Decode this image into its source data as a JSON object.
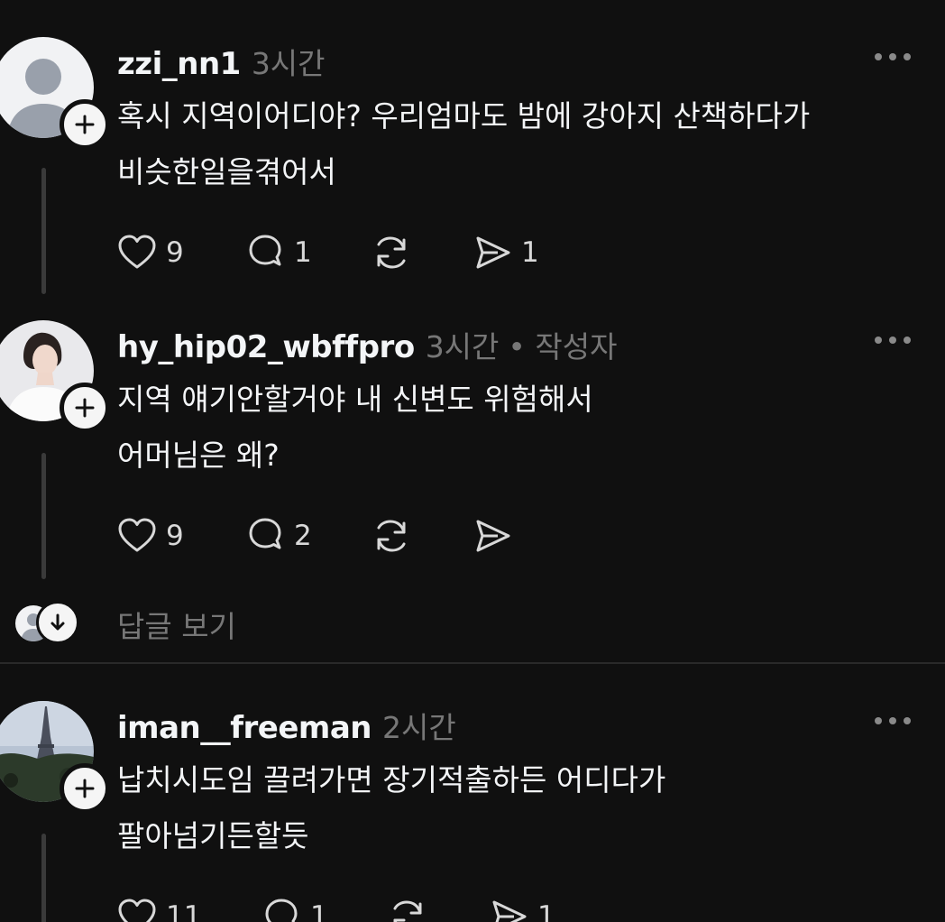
{
  "comments": [
    {
      "username": "zzi_nn1",
      "time": "3시간",
      "author_tag": "",
      "lines": [
        "혹시 지역이어디야? 우리엄마도 밤에 강아지 산책하다가",
        "비슷한일을겪어서"
      ],
      "likes": "9",
      "replies": "1",
      "reposts": "",
      "shares": "1",
      "avatar": "default-avatar"
    },
    {
      "username": "hy_hip02_wbffpro",
      "time": "3시간",
      "author_tag": "• 작성자",
      "lines": [
        "지역 얘기안할거야 내 신변도 위험해서",
        "어머님은 왜?"
      ],
      "likes": "9",
      "replies": "2",
      "reposts": "",
      "shares": "",
      "avatar": "woman-portrait-avatar"
    },
    {
      "username": "iman__freeman",
      "time": "2시간",
      "author_tag": "",
      "lines": [
        "납치시도임 끌려가면 장기적출하든 어디다가",
        "팔아넘기든할듯"
      ],
      "likes": "11",
      "replies": "1",
      "reposts": "",
      "shares": "1",
      "avatar": "eiffel-tower-avatar"
    }
  ],
  "view_replies_label": "답글 보기",
  "colors": {
    "background": "#101010",
    "text": "#f3f5f7",
    "muted": "#777777",
    "icon": "#d8d8d8"
  }
}
